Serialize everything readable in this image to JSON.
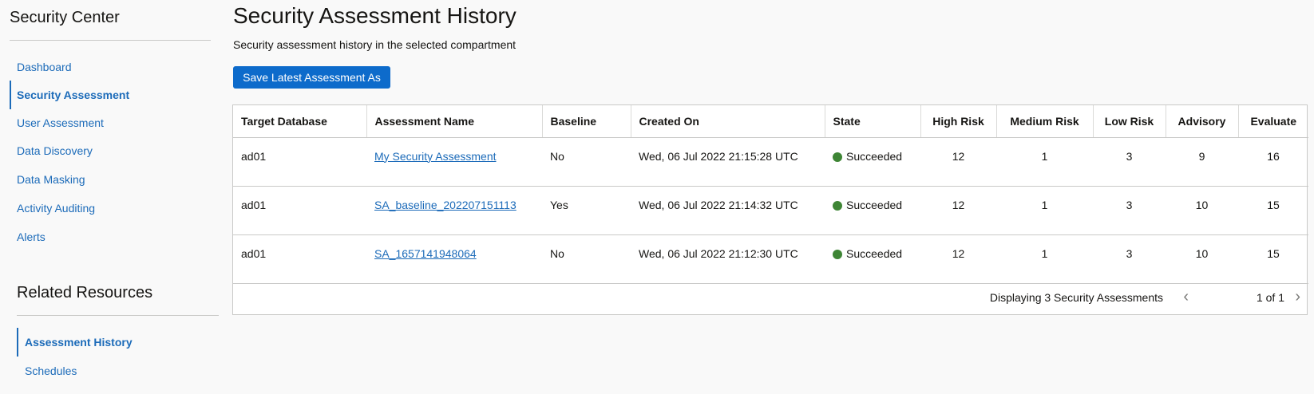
{
  "sidebar": {
    "title": "Security Center",
    "items": [
      {
        "label": "Dashboard",
        "active": false
      },
      {
        "label": "Security Assessment",
        "active": true
      },
      {
        "label": "User Assessment",
        "active": false
      },
      {
        "label": "Data Discovery",
        "active": false
      },
      {
        "label": "Data Masking",
        "active": false
      },
      {
        "label": "Activity Auditing",
        "active": false
      },
      {
        "label": "Alerts",
        "active": false
      }
    ],
    "related_title": "Related Resources",
    "related_items": [
      {
        "label": "Assessment History",
        "active": true
      },
      {
        "label": "Schedules",
        "active": false
      }
    ]
  },
  "main": {
    "title": "Security Assessment History",
    "subtitle": "Security assessment history in the selected compartment",
    "save_button": "Save Latest Assessment As",
    "table": {
      "columns": [
        "Target Database",
        "Assessment Name",
        "Baseline",
        "Created On",
        "State",
        "High Risk",
        "Medium Risk",
        "Low Risk",
        "Advisory",
        "Evaluate"
      ],
      "rows": [
        [
          "ad01",
          "My Security Assessment",
          "No",
          "Wed, 06 Jul 2022 21:15:28 UTC",
          "Succeeded",
          "12",
          "1",
          "3",
          "9",
          "16"
        ],
        [
          "ad01",
          "SA_baseline_202207151113",
          "Yes",
          "Wed, 06 Jul 2022 21:14:32 UTC",
          "Succeeded",
          "12",
          "1",
          "3",
          "10",
          "15"
        ],
        [
          "ad01",
          "SA_1657141948064",
          "No",
          "Wed, 06 Jul 2022 21:12:30 UTC",
          "Succeeded",
          "12",
          "1",
          "3",
          "10",
          "15"
        ]
      ]
    },
    "footer": {
      "count_text": "Displaying 3 Security Assessments",
      "page_text": "1 of 1"
    }
  },
  "colors": {
    "accent": "#1c6bb9",
    "button": "#0d6bcb",
    "success": "#3e8535"
  }
}
